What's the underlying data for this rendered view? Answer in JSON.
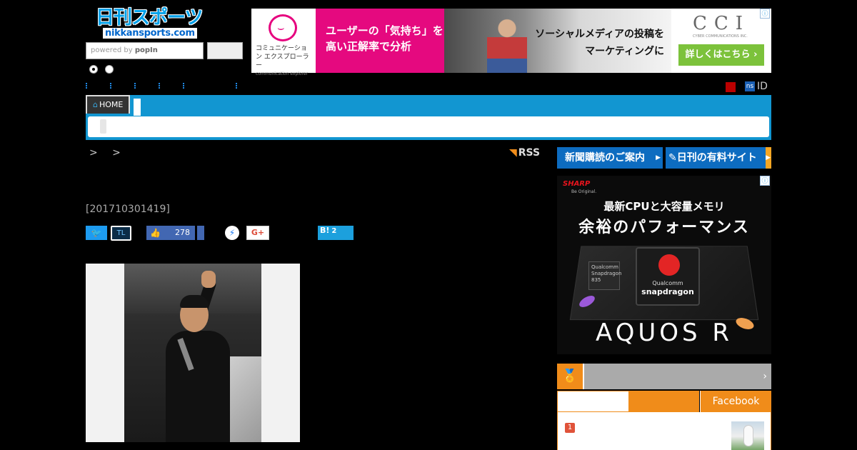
{
  "header": {
    "logo_text": "日刊スポーツ",
    "logo_sub": "nikkansports.com",
    "search": {
      "powered_by": "powered by",
      "provider": "popIn"
    }
  },
  "top_ad": {
    "brand_small": "コミュニケーション エクスプローラー",
    "brand_tiny": "communication explorer",
    "headline_line1": "ユーザーの「気持ち」を",
    "headline_line2": "高い正解率で分析",
    "photo_line1": "ソーシャルメディアの投稿を",
    "photo_line2": "マーケティングに",
    "cci_logo": "CCI",
    "cci_sub": "CYBER COMMUNICATIONS INC.",
    "cta": "詳しくはこちら ›",
    "info_icon": "ⓘ"
  },
  "account": {
    "ns_label": "ns",
    "id_label": "ID"
  },
  "nav": {
    "home_label": "HOME"
  },
  "breadcrumb": {
    "text": "> >"
  },
  "rss": {
    "label": "RSS"
  },
  "article": {
    "id": "[201710301419]"
  },
  "share": {
    "twitter_icon": "🐦",
    "tl_label": "TL",
    "like_count": "278",
    "gplus_label": "G+",
    "hatena_label": "B!",
    "hatena_count": "2"
  },
  "sidebar": {
    "subscribe_label": "新聞購読のご案内",
    "paid_label": "日刊の有料サイト",
    "ad": {
      "brand": "SHARP",
      "brand_tagline": "Be Original.",
      "headline1": "最新CPUと大容量メモリ",
      "headline2": "余裕のパフォーマンス",
      "chip_brand": "Qualcomm",
      "chip_name": "snapdragon",
      "mini_chip": "Qualcomm Snapdragon 835",
      "product": "AQUOS R",
      "info_icon": "ⓘ"
    },
    "ranking": {
      "chevron": "›",
      "tabs": [
        "",
        "",
        "Facebook"
      ],
      "items": [
        {
          "rank": "1"
        }
      ]
    }
  }
}
